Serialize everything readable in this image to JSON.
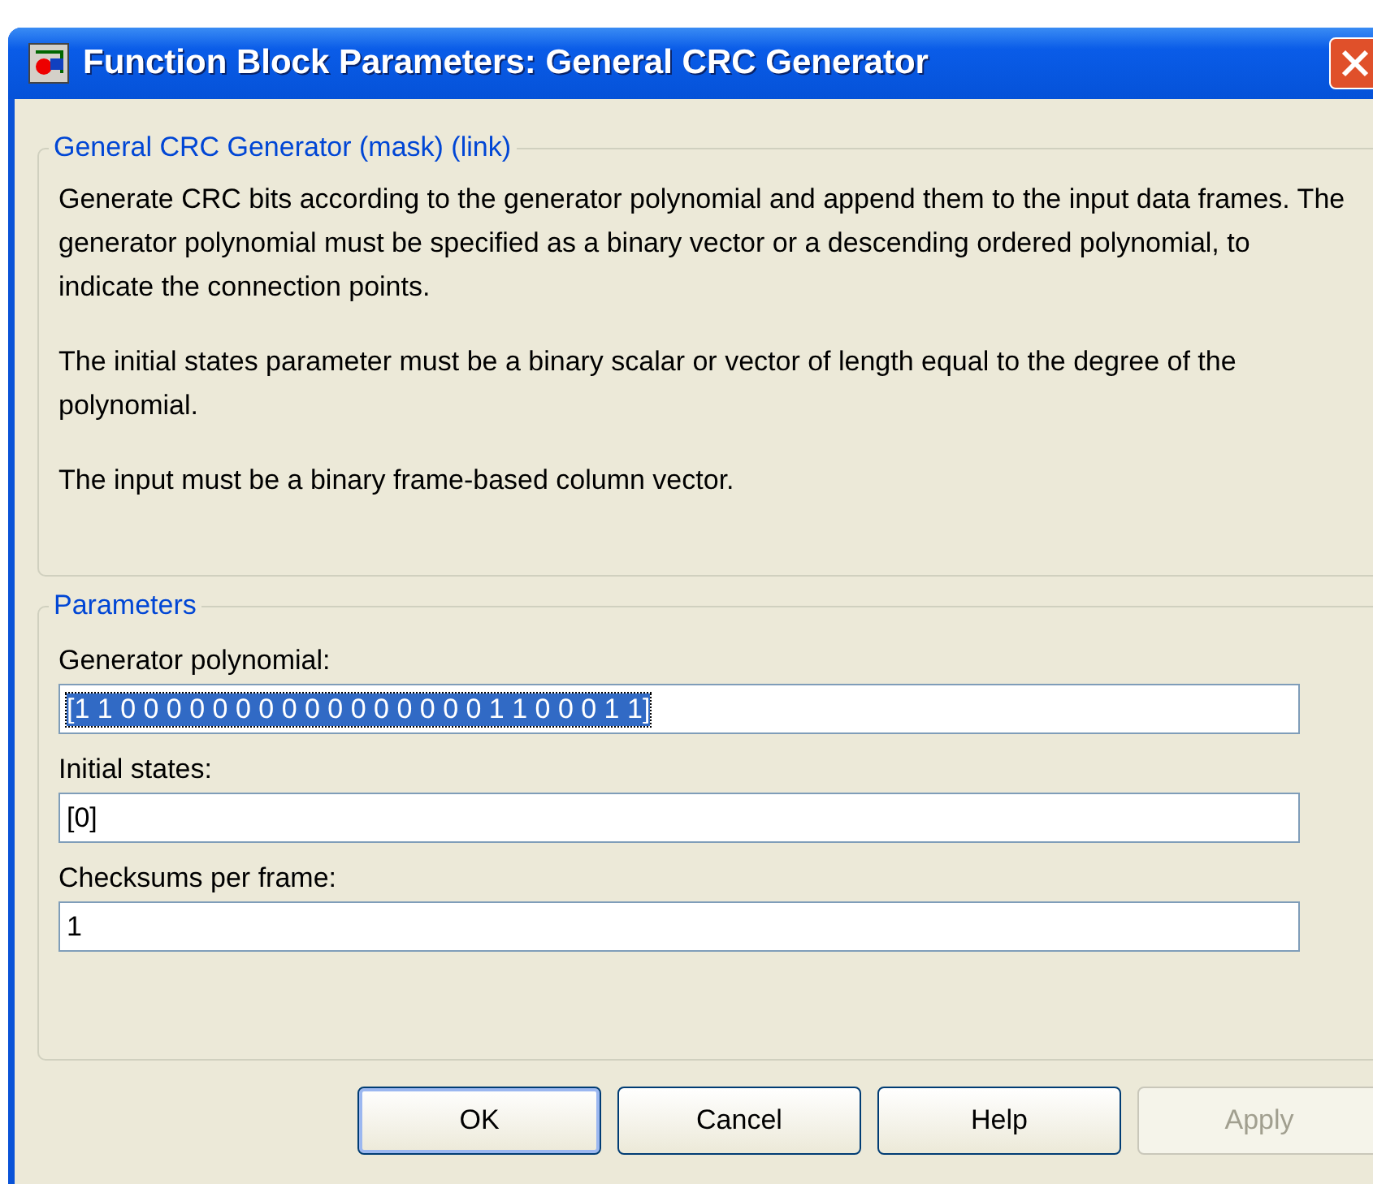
{
  "window": {
    "title": "Function Block Parameters: General CRC Generator"
  },
  "description": {
    "legend": "General CRC Generator (mask) (link)",
    "paragraphs": [
      "Generate CRC bits according to the generator polynomial and append them to the input data frames. The generator polynomial must be specified as a binary vector or a descending ordered polynomial, to indicate the connection points.",
      "The initial states parameter must be a binary scalar or vector of length equal to the degree of the polynomial.",
      "The input must be a binary frame-based column vector."
    ]
  },
  "parameters": {
    "legend": "Parameters",
    "fields": [
      {
        "label": "Generator polynomial:",
        "value": "[1 1 0 0 0 0 0 0 0 0 0 0 0 0 0 0 0 0 1 1 0 0 0 1 1]",
        "selected": true
      },
      {
        "label": "Initial states:",
        "value": "[0]",
        "selected": false
      },
      {
        "label": "Checksums per frame:",
        "value": "1",
        "selected": false
      }
    ]
  },
  "buttons": [
    {
      "label": "OK",
      "disabled": false,
      "default": true
    },
    {
      "label": "Cancel",
      "disabled": false,
      "default": false
    },
    {
      "label": "Help",
      "disabled": false,
      "default": false
    },
    {
      "label": "Apply",
      "disabled": true,
      "default": false
    }
  ]
}
